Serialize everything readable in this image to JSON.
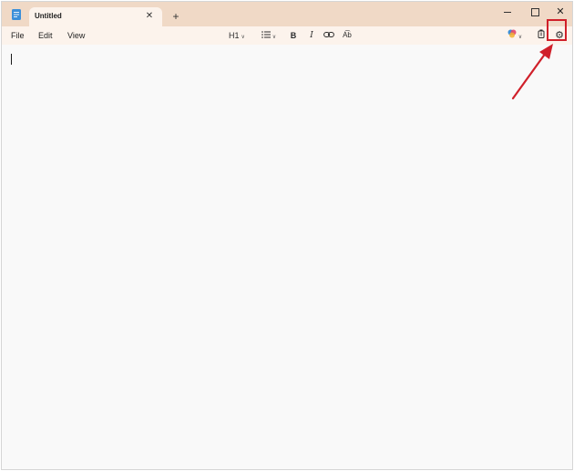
{
  "window": {
    "tab_title": "Untitled",
    "close_tab": "✕",
    "new_tab": "+",
    "close_window": "✕"
  },
  "menu": {
    "file": "File",
    "edit": "Edit",
    "view": "View"
  },
  "toolbar": {
    "heading": "H1",
    "bold": "B",
    "italic": "I",
    "spell": "A͡b",
    "settings_glyph": "⚙"
  },
  "editor": {
    "content": ""
  },
  "colors": {
    "titlebar": "#f0d9c6",
    "toolbar": "#fcf3ec",
    "editor_bg": "#f9f9f9",
    "annotation_red": "#d0202a"
  }
}
